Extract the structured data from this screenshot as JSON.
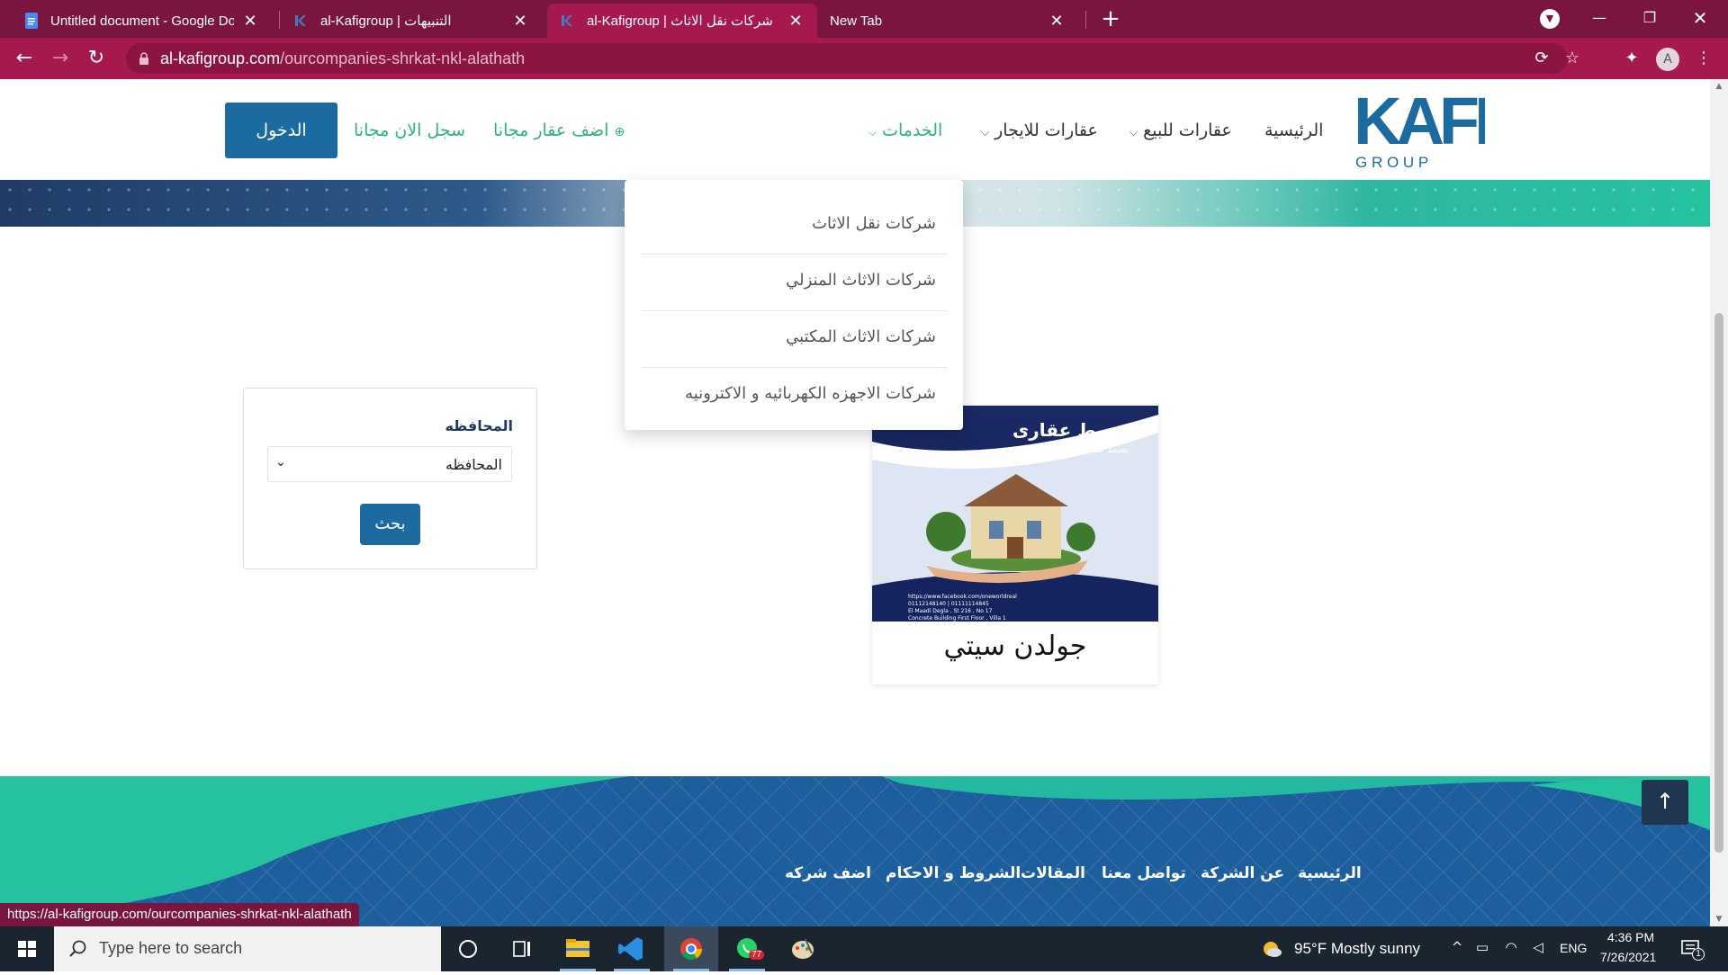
{
  "browser": {
    "tabs": [
      {
        "title": "Untitled document - Google Doc",
        "icon": "google-docs-icon",
        "active": false
      },
      {
        "title": "al-Kafigroup | التنبيهات",
        "icon": "kafi-icon",
        "active": false
      },
      {
        "title": "al-Kafigroup | شركات نقل الاثاث",
        "icon": "kafi-icon",
        "active": true
      },
      {
        "title": "New Tab",
        "icon": "",
        "active": false
      }
    ],
    "url_domain": "al-kafigroup.com",
    "url_path": "/ourcompanies-shrkat-nkl-alathath",
    "profile_initial": "A",
    "status_url": "https://al-kafigroup.com/ourcompanies-shrkat-nkl-alathath",
    "colors": {
      "frame": "#7a1540",
      "toolbar": "#a5194f"
    }
  },
  "site": {
    "logo": {
      "word": "KAFI",
      "sub": "G R O U P"
    },
    "nav": {
      "home": "الرئيسية",
      "for_sale": "عقارات للبيع",
      "for_rent": "عقارات للايجار",
      "services": "الخدمات",
      "add_property": "اضف عقار مجانا",
      "register": "سجل الان مجانا",
      "login": "الدخول"
    },
    "services_menu": [
      "شركات نقل الاثاث",
      "شركات الاثاث المنزلي",
      "شركات الاثاث المكتبي",
      "شركات الاجهزه الكهربائيه و الاكترونيه"
    ],
    "search": {
      "label": "المحافظه",
      "select_value": "المحافظه",
      "button": "بحث"
    },
    "company": {
      "name": "جولدن سيتي",
      "ad_headline": "وسيط عقارى",
      "ad_tagline": ".. يعتمد عليه",
      "ad_lines": [
        "https://www.facebook.com/oneworldreal",
        "01112148140 | 01111114845",
        "El Maadi Degla , St 216 , No 17",
        "Concrete Building First Floor , Villa 1"
      ]
    },
    "footer_links": [
      "الرئيسية",
      "عن الشركة",
      "تواصل معنا",
      "المقالات",
      "الشروط و الاحكام",
      "اضف شركه"
    ],
    "colors": {
      "primary": "#1b6aa0",
      "accent": "#2bb673",
      "footer": "#1d5e9c",
      "footer_wave": "#25c2a0"
    }
  },
  "taskbar": {
    "search_placeholder": "Type here to search",
    "weather": "95°F  Mostly sunny",
    "language": "ENG",
    "time": "4:36 PM",
    "date": "7/26/2021",
    "whatsapp_badge": "77",
    "notification_count": "1"
  }
}
